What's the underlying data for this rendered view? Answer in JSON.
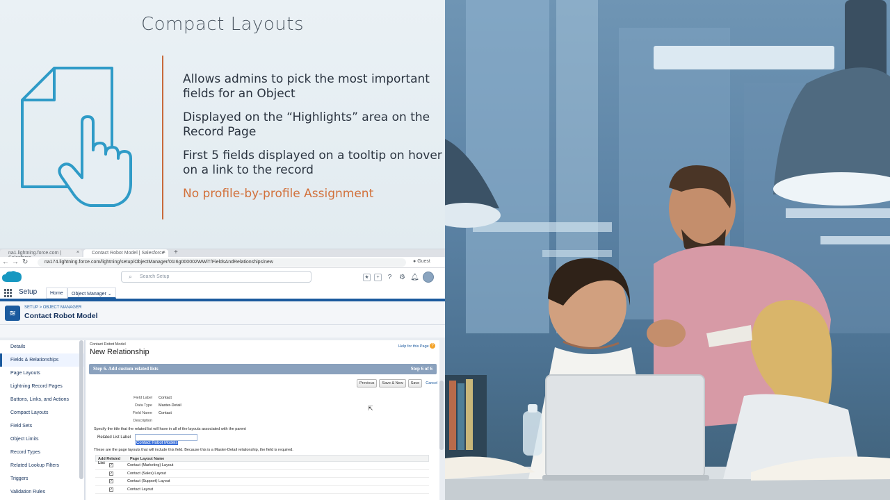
{
  "slide": {
    "title": "Compact Layouts",
    "bullets": [
      "Allows admins to pick the most important fields for an Object",
      "Displayed on the “Highlights” area on the Record Page",
      "First 5 fields displayed on a tooltip on hover on a link to the record"
    ],
    "accent_bullet": "No profile-by-profile Assignment",
    "accent_color": "#d2703a",
    "icon": "document-tap-icon"
  },
  "browser": {
    "tabs": [
      {
        "label": "na1.lightning.force.com | Salesforce"
      },
      {
        "label": "Contact Robot Model | Salesforce"
      }
    ],
    "url": "na174.lightning.force.com/lightning/setup/ObjectManager/01I6g000002WWiT/FieldsAndRelationships/new",
    "profile": "Guest"
  },
  "salesforce": {
    "search_placeholder": "Search Setup",
    "app_name": "Setup",
    "nav_tabs": [
      "Home",
      "Object Manager"
    ],
    "breadcrumb": "SETUP > OBJECT MANAGER",
    "object_title": "Contact Robot Model",
    "left_nav": [
      "Details",
      "Fields & Relationships",
      "Page Layouts",
      "Lightning Record Pages",
      "Buttons, Links, and Actions",
      "Compact Layouts",
      "Field Sets",
      "Object Limits",
      "Record Types",
      "Related Lookup Filters",
      "Triggers",
      "Validation Rules"
    ],
    "active_nav": "Fields & Relationships",
    "brand_color": "#1b5a9e"
  },
  "wizard": {
    "object_small": "Contact Robot Model",
    "title": "New Relationship",
    "help_link": "Help for this Page",
    "step_title": "Step 6. Add custom related lists",
    "step_count": "Step 6 of 6",
    "buttons": [
      "Previous",
      "Save & New",
      "Save"
    ],
    "cancel": "Cancel",
    "fields": [
      {
        "label": "Field Label",
        "value": "Contact"
      },
      {
        "label": "Data Type",
        "value": "Master-Detail"
      },
      {
        "label": "Field Name",
        "value": "Contact"
      },
      {
        "label": "Description",
        "value": ""
      }
    ],
    "specify_text": "Specify the title that the related list will have in all of the layouts associated with the parent",
    "related_list_label": "Related List Label",
    "related_list_value": "Contact Robot Models",
    "layouts_text": "These are the page layouts that will include this field. Because this is a Master-Detail relationship, the field is required.",
    "table_headers": [
      "Add Related List",
      "Page Layout Name"
    ],
    "layouts": [
      {
        "checked": true,
        "name": "Contact (Marketing) Layout"
      },
      {
        "checked": true,
        "name": "Contact (Sales) Layout"
      },
      {
        "checked": true,
        "name": "Contact (Support) Layout"
      },
      {
        "checked": true,
        "name": "Contact Layout"
      }
    ]
  }
}
